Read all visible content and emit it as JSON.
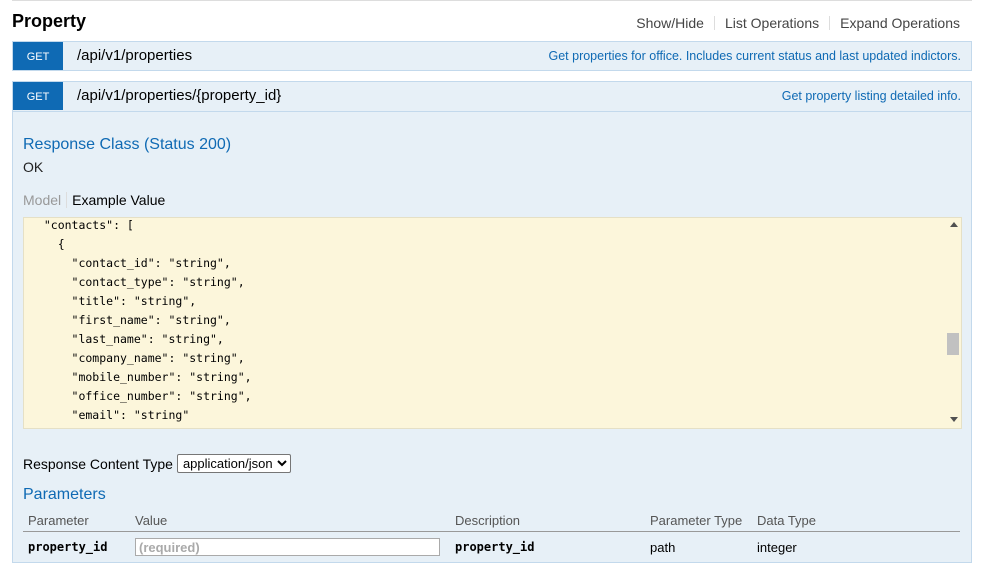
{
  "resource": {
    "title": "Property",
    "links": [
      "Show/Hide",
      "List Operations",
      "Expand Operations"
    ]
  },
  "operations": [
    {
      "method": "GET",
      "path": "/api/v1/properties",
      "summary": "Get properties for office. Includes current status and last updated indictors."
    },
    {
      "method": "GET",
      "path": "/api/v1/properties/{property_id}",
      "summary": "Get property listing detailed info."
    }
  ],
  "response": {
    "class_title": "Response Class (Status 200)",
    "status_text": "OK",
    "tabs": {
      "model": "Model",
      "example": "Example Value"
    },
    "example_lines": [
      "  \"contacts\": [",
      "    {",
      "      \"contact_id\": \"string\",",
      "      \"contact_type\": \"string\",",
      "      \"title\": \"string\",",
      "      \"first_name\": \"string\",",
      "      \"last_name\": \"string\",",
      "      \"company_name\": \"string\",",
      "      \"mobile_number\": \"string\",",
      "      \"office_number\": \"string\",",
      "      \"email\": \"string\""
    ],
    "content_type_label": "Response Content Type",
    "content_type_options": [
      "application/json"
    ],
    "content_type_selected": "application/json"
  },
  "parameters": {
    "title": "Parameters",
    "columns": [
      "Parameter",
      "Value",
      "Description",
      "Parameter Type",
      "Data Type"
    ],
    "rows": [
      {
        "name": "property_id",
        "placeholder": "(required)",
        "description": "property_id",
        "param_type": "path",
        "data_type": "integer"
      }
    ]
  },
  "colors": {
    "accent": "#0f6ab4",
    "operation_bg": "#e7f0f7",
    "snippet_bg": "#fcf6db"
  }
}
